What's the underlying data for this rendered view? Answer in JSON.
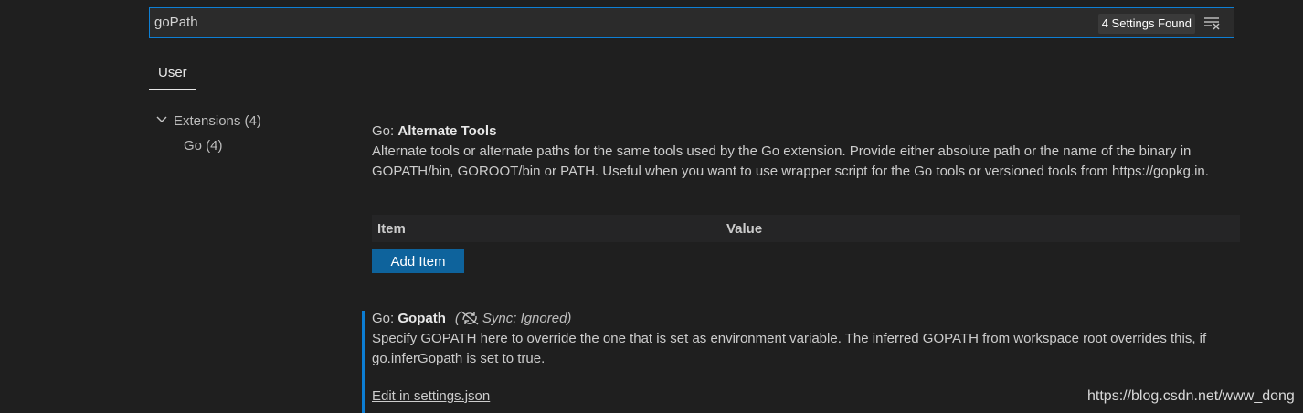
{
  "search": {
    "value": "goPath",
    "results_badge": "4 Settings Found",
    "clear_icon": "clear-filter-icon"
  },
  "tabs": [
    {
      "label": "User",
      "active": true
    }
  ],
  "toc": {
    "items": [
      {
        "label": "Extensions (4)",
        "expanded": true,
        "icon": "chevron-down-icon"
      },
      {
        "label": "Go (4)"
      }
    ]
  },
  "settings": {
    "alternate_tools": {
      "category": "Go: ",
      "name": "Alternate Tools",
      "description": "Alternate tools or alternate paths for the same tools used by the Go extension. Provide either absolute path or the name of the binary in GOPATH/bin, GOROOT/bin or PATH. Useful when you want to use wrapper script for the Go tools or versioned tools from https://gopkg.in.",
      "table_headers": {
        "item": "Item",
        "value": "Value"
      },
      "add_button": "Add Item"
    },
    "gopath": {
      "category": "Go: ",
      "name": "Gopath",
      "sync_note_prefix": "(",
      "sync_note": "Sync: Ignored)",
      "sync_icon": "sync-ignored-icon",
      "description": "Specify GOPATH here to override the one that is set as environment variable. The inferred GOPATH from workspace root overrides this, if go.inferGopath is set to true.",
      "edit_link": "Edit in settings.json"
    }
  },
  "watermark": "https://blog.csdn.net/www_dong",
  "colors": {
    "focus_border": "#0e7fd4",
    "button_bg": "#0e639c",
    "modified_bar": "#0c7dd3",
    "background": "#1f1f1f"
  }
}
